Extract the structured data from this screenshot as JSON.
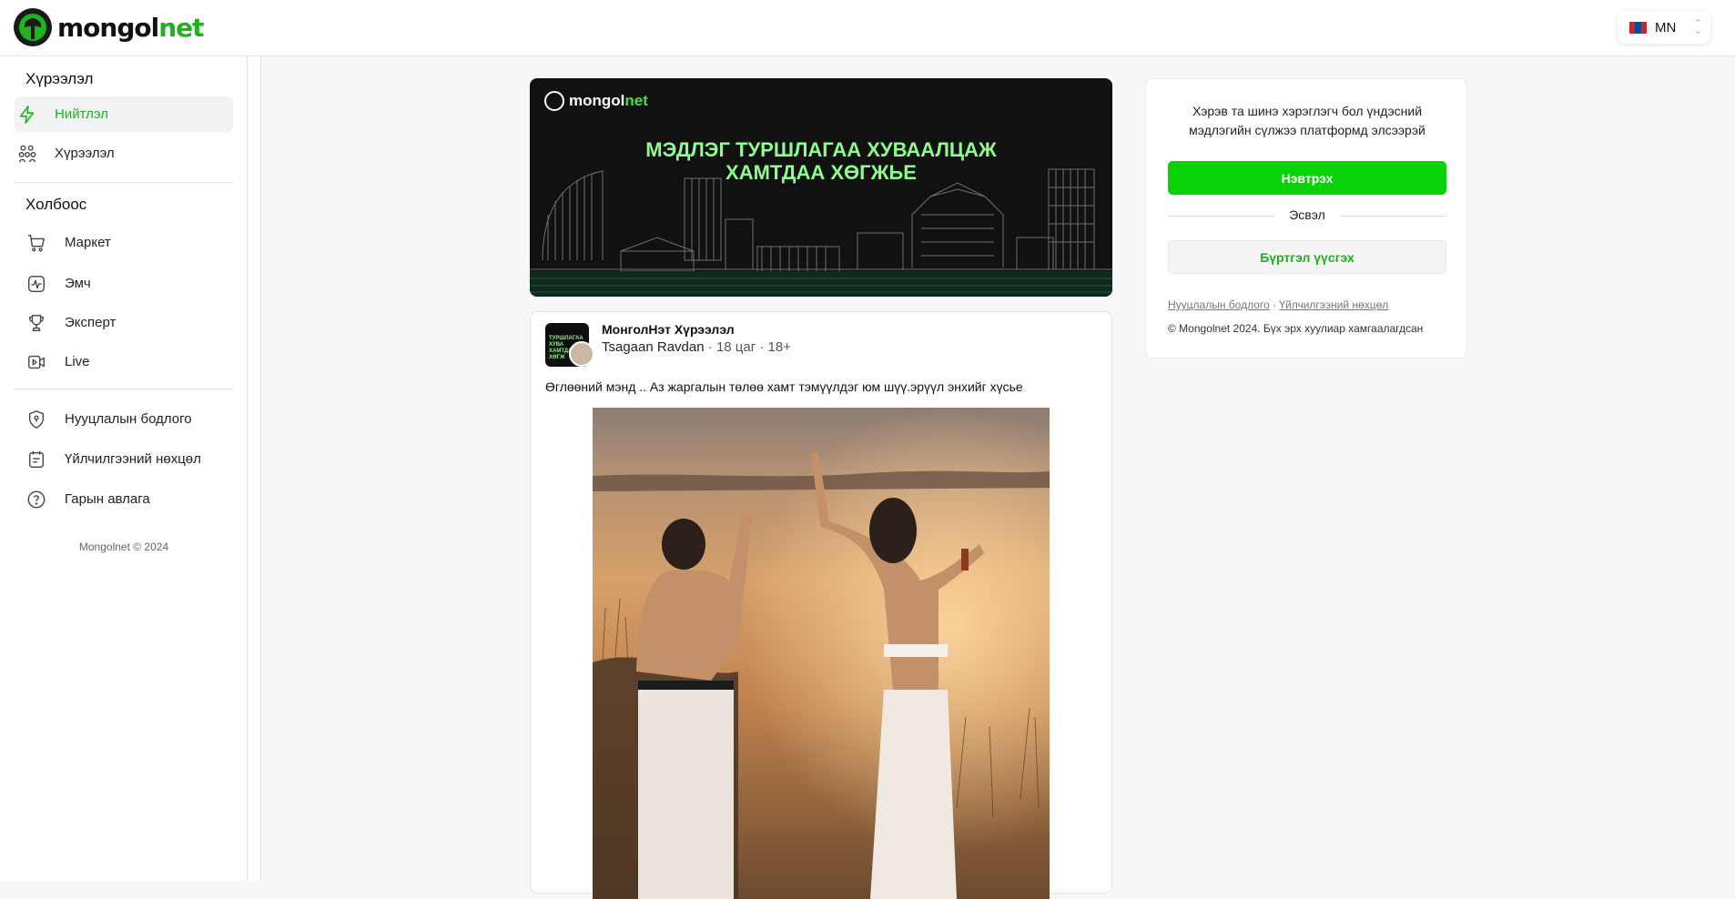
{
  "header": {
    "logo_main": "mongol",
    "logo_accent": "net",
    "language_code": "MN",
    "flag_colors": [
      "#c4272f",
      "#015197",
      "#c4272f"
    ]
  },
  "sidebar": {
    "section_community": "Хүрээлэл",
    "items_top": [
      {
        "label": "Нийтлэл",
        "icon": "lightning-icon",
        "active": true
      },
      {
        "label": "Хүрээлэл",
        "icon": "people-icon",
        "active": false
      }
    ],
    "section_links": "Холбоос",
    "items_links": [
      {
        "label": "Маркет",
        "icon": "cart-icon"
      },
      {
        "label": "Эмч",
        "icon": "heartbeat-icon"
      },
      {
        "label": "Эксперт",
        "icon": "trophy-icon"
      },
      {
        "label": "Live",
        "icon": "video-icon"
      }
    ],
    "items_bottom": [
      {
        "label": "Нууцлалын бодлого",
        "icon": "shield-icon"
      },
      {
        "label": "Үйлчилгээний нөхцөл",
        "icon": "document-icon"
      },
      {
        "label": "Гарын авлага",
        "icon": "help-icon"
      }
    ],
    "copyright": "Mongolnet © 2024"
  },
  "banner": {
    "logo_main": "mongol",
    "logo_accent": "net",
    "headline_line1": "МЭДЛЭГ ТУРШЛАГАА ХУВААЛЦАЖ",
    "headline_line2": "ХАМТДАА ХӨГЖЬЕ"
  },
  "post": {
    "group": "МонголНэт Хүрээлэл",
    "avatar_text": "ТУРШЛАГАА ХУВА ХАМТДАА ХӨГЖ",
    "author": "Tsagaan Ravdan",
    "time": "18 цаг",
    "rating": "18+",
    "separator": " · ",
    "text": "Өглөөний мэнд .. Аз жаргалын төлөө хамт тэмүүлдэг юм шүү.эрүүл энхийг хүсье"
  },
  "auth": {
    "message": "Хэрэв та шинэ хэрэглэгч бол үндэсний мэдлэгийн сүлжээ платформд элсээрэй",
    "login_label": "Нэвтрэх",
    "or_label": "Эсвэл",
    "register_label": "Бүртгэл үүсгэх",
    "privacy_link": "Нууцлалын бодлого",
    "terms_link": "Үйлчилгээний нөхцөл",
    "link_separator": " · ",
    "copyright": "© Mongolnet 2024. Бүх эрх хуулиар хамгаалагдсан"
  },
  "colors": {
    "accent": "#07d307",
    "accent_text": "#1db31d"
  }
}
